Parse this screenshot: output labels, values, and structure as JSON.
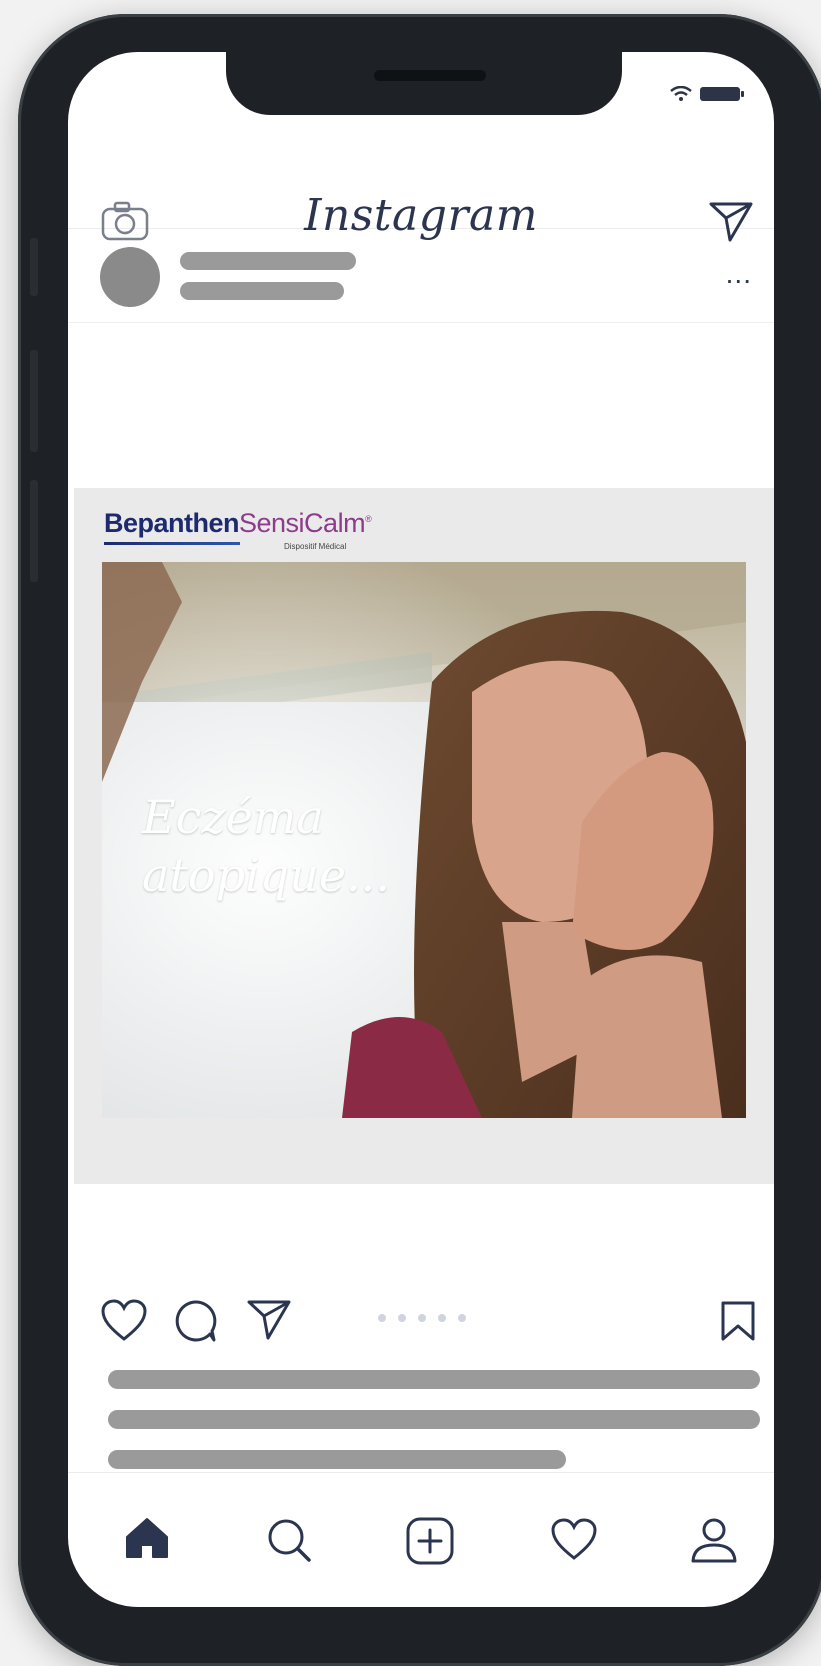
{
  "app": {
    "title": "Instagram"
  },
  "post": {
    "more_label": "...",
    "ad": {
      "brand_primary": "Bepanthen",
      "brand_secondary": "SensiCalm",
      "brand_mark": "®",
      "brand_subtitle": "Dispositif Médical",
      "caption": "Eczéma\natopique..."
    }
  },
  "icons": {
    "header": [
      "camera-icon",
      "send-icon"
    ],
    "actions": [
      "heart-icon",
      "comment-icon",
      "send-icon",
      "bookmark-icon"
    ],
    "tabs": [
      "home-icon",
      "search-icon",
      "add-icon",
      "heart-icon",
      "profile-icon"
    ]
  },
  "colors": {
    "accent": "#2c3550",
    "brand_blue": "#1d2a6e",
    "brand_purple": "#8e3b8c",
    "placeholder": "#9a9a9a"
  }
}
